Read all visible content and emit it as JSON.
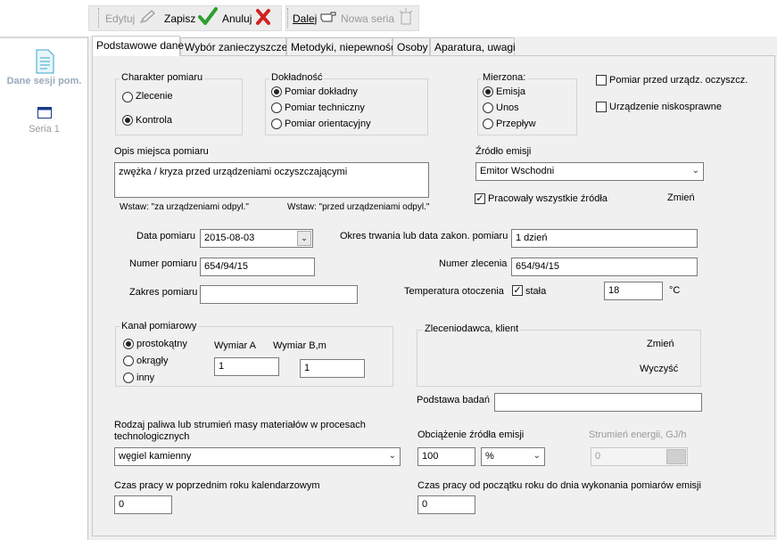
{
  "toolbar": {
    "edit": "Edytuj",
    "save": "Zapisz",
    "cancel": "Anuluj",
    "next": "Dalej",
    "new_series": "Nowa seria"
  },
  "nav": {
    "session": "Dane sesji pom.",
    "series": "Seria 1"
  },
  "tabs": [
    "Podstawowe dane",
    "Wybór zanieczyszczeń",
    "Metodyki, niepewność",
    "Osoby",
    "Aparatura, uwagi"
  ],
  "charakter": {
    "title": "Charakter pomiaru",
    "options": [
      "Zlecenie",
      "Kontrola"
    ],
    "selected": "Kontrola"
  },
  "dokladnosc": {
    "title": "Dokładność",
    "options": [
      "Pomiar dokładny",
      "Pomiar techniczny",
      "Pomiar orientacyjny"
    ],
    "selected": "Pomiar dokładny"
  },
  "mierzona": {
    "title": "Mierzona:",
    "options": [
      "Emisja",
      "Unos",
      "Przepływ"
    ],
    "selected": "Emisja"
  },
  "checks": {
    "przed_urzadz": "Pomiar przed urządz. oczyszcz.",
    "niskosprawne": "Urządzenie niskosprawne",
    "pracowaly": "Pracowały wszystkie źródła",
    "stala": "stała"
  },
  "opis": {
    "label": "Opis miejsca pomiaru",
    "value": "zwężka / kryza  przed urządzeniami oczyszczającymi",
    "insert1": "Wstaw: \"za urządzeniami odpyl.\"",
    "insert2": "Wstaw: \"przed urządzeniami odpyl.\""
  },
  "zrodlo": {
    "label": "Źródło emisji",
    "value": "Emitor Wschodni",
    "change": "Zmień"
  },
  "data_pomiaru": {
    "label": "Data pomiaru",
    "value": "2015-08-03"
  },
  "okres": {
    "label": "Okres trwania lub data zakon. pomiaru",
    "value": "1 dzień"
  },
  "numer_pomiaru": {
    "label": "Numer pomiaru",
    "value": "654/94/15"
  },
  "numer_zlecenia": {
    "label": "Numer zlecenia",
    "value": "654/94/15"
  },
  "zakres": {
    "label": "Zakres pomiaru",
    "value": ""
  },
  "temperatura": {
    "label": "Temperatura otoczenia",
    "value": "18",
    "unit": "°C"
  },
  "kanal": {
    "title": "Kanał pomiarowy",
    "options": [
      "prostokątny",
      "okrągły",
      "inny"
    ],
    "selected": "prostokątny",
    "dimA_label": "Wymiar A",
    "dimB_label": "Wymiar B,m",
    "dimA": "1",
    "dimB": "1"
  },
  "zleceniodawca": {
    "title": "Zleceniodawca, klient",
    "change": "Zmień",
    "clear": "Wyczyść"
  },
  "podstawa": {
    "label": "Podstawa badań",
    "value": ""
  },
  "paliwo": {
    "label": "Rodzaj paliwa lub strumień masy materiałów w procesach technologicznych",
    "value": "węgiel kamienny"
  },
  "obciazenie": {
    "label": "Obciążenie źródła emisji",
    "value": "100",
    "unit": "%"
  },
  "strumien": {
    "label": "Strumień energii, GJ/h",
    "value": "0"
  },
  "czas_poprz": {
    "label": "Czas pracy w poprzednim roku kalendarzowym",
    "value": "0"
  },
  "czas_od_pocz": {
    "label": "Czas pracy od początku roku do dnia wykonania pomiarów emisji",
    "value": "0"
  },
  "colors": {
    "accent_green": "#2e9e2e",
    "cancel_red": "#d42020",
    "nav_icon": "#3aa6c8"
  }
}
